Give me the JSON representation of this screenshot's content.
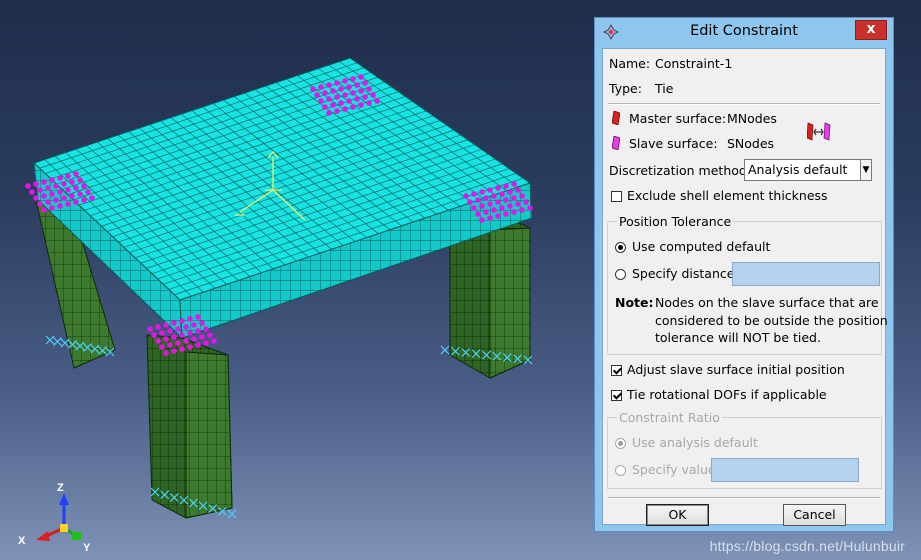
{
  "dialog": {
    "title": "Edit Constraint",
    "name_label": "Name:",
    "name_value": "Constraint-1",
    "type_label": "Type:",
    "type_value": "Tie",
    "master_label": "Master surface:",
    "master_value": "MNodes",
    "slave_label": "Slave surface:",
    "slave_value": "SNodes",
    "discretization_label": "Discretization method:",
    "discretization_value": "Analysis default",
    "exclude_shell_label": "Exclude shell element thickness",
    "exclude_shell_checked": false,
    "position_tolerance": {
      "title": "Position Tolerance",
      "use_computed_label": "Use computed default",
      "use_computed_selected": true,
      "specify_distance_label": "Specify distance:",
      "specify_distance_value": "",
      "note_label": "Note:",
      "note_line1": "Nodes on the slave surface that are",
      "note_line2": "considered to be outside the position",
      "note_line3": "tolerance will NOT be tied."
    },
    "adjust_slave_label": "Adjust slave surface initial position",
    "adjust_slave_checked": true,
    "tie_rotational_label": "Tie rotational DOFs if applicable",
    "tie_rotational_checked": true,
    "constraint_ratio": {
      "title": "Constraint Ratio",
      "use_analysis_label": "Use analysis default",
      "use_analysis_selected": true,
      "specify_value_label": "Specify value:",
      "specify_value_value": "",
      "enabled": false
    },
    "ok_label": "OK",
    "cancel_label": "Cancel",
    "close_symbol": "x"
  },
  "triad": {
    "x_label": "X",
    "y_label": "Y",
    "z_label": "Z"
  },
  "watermark": "https://blog.csdn.net/Hulunbuir",
  "colors": {
    "slab": "#18e3e3",
    "legs": "#3d7a2d",
    "surface_markers": "#e516e5",
    "dialog_frame": "#8ec6ee",
    "close_button": "#c9302c"
  },
  "icons": [
    "dialog-app-icon",
    "master-surface-icon",
    "slave-surface-icon",
    "swap-surfaces-icon",
    "select-arrow-icon"
  ]
}
